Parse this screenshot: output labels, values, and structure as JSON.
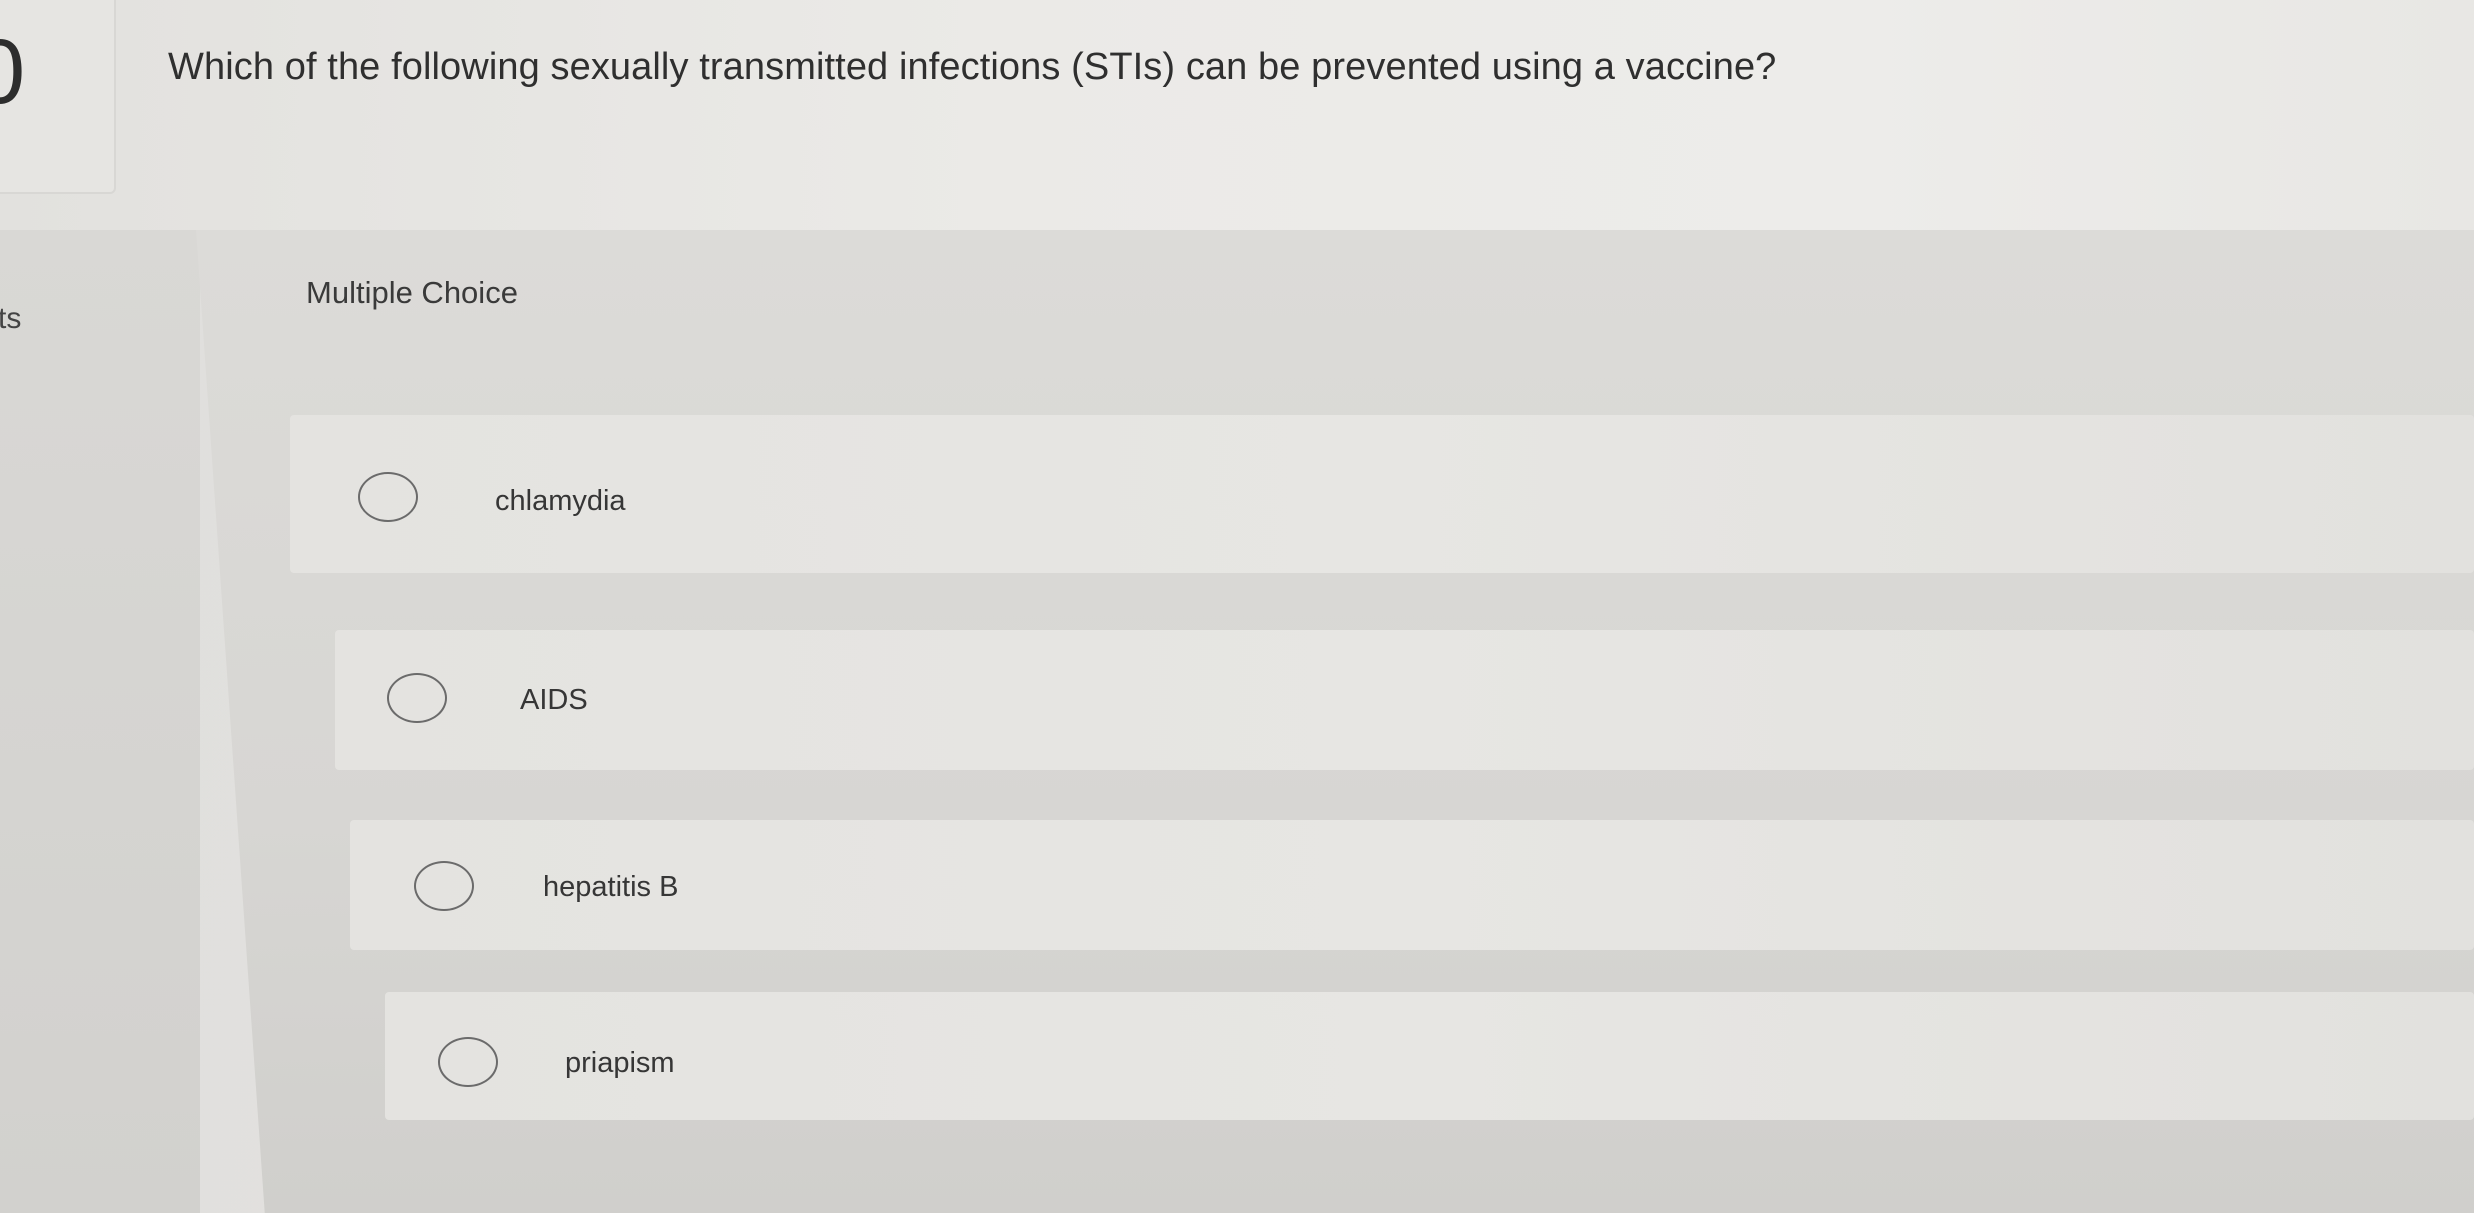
{
  "question": {
    "number": "0",
    "points_label": "ts",
    "text": "Which of the following sexually transmitted infections (STIs) can be prevented using a vaccine?"
  },
  "answers": {
    "type_label": "Multiple Choice",
    "options": [
      {
        "label": "chlamydia"
      },
      {
        "label": "AIDS"
      },
      {
        "label": "hepatitis B"
      },
      {
        "label": "priapism"
      }
    ]
  }
}
